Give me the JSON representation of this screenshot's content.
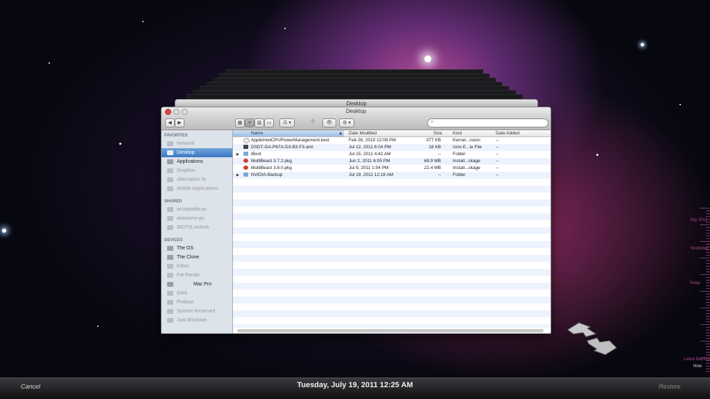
{
  "window": {
    "back_title": "Desktop",
    "title": "Desktop",
    "toolbar": {
      "back_label": "◀",
      "forward_label": "▶",
      "view_icons": [
        "icon-view-icon",
        "list-view-icon",
        "column-view-icon",
        "coverflow-view-icon"
      ],
      "arrange_label": "☰ ▾",
      "quicklook_label": "👁",
      "action_label": "⚙ ▾"
    }
  },
  "sidebar": {
    "sections": [
      {
        "title": "FAVORITES",
        "items": [
          {
            "label": "Network",
            "state": "dim"
          },
          {
            "label": "Desktop",
            "state": "selected"
          },
          {
            "label": "Applications",
            "state": "active"
          },
          {
            "label": "Dropbox",
            "state": "dim"
          },
          {
            "label": "Alternative To",
            "state": "dim"
          },
          {
            "label": "Mobile Applications",
            "state": "dim"
          }
        ]
      },
      {
        "title": "SHARED",
        "items": [
          {
            "label": "acceptable-pc",
            "state": "dim"
          },
          {
            "label": "awesome-pc",
            "state": "dim"
          },
          {
            "label": "WDTVLiveHub",
            "state": "dim"
          }
        ]
      },
      {
        "title": "DEVICES",
        "items": [
          {
            "label": "The OS",
            "state": "active"
          },
          {
            "label": "The Clone",
            "state": "active"
          },
          {
            "label": "Kitten",
            "state": "dim"
          },
          {
            "label": "Fat Panda",
            "state": "dim"
          },
          {
            "label": "Mac Pro",
            "state": "active"
          },
          {
            "label": "iDisk",
            "state": "dim"
          },
          {
            "label": "Preboot",
            "state": "dim"
          },
          {
            "label": "System Reserved",
            "state": "dim"
          },
          {
            "label": "Just Windows",
            "state": "dim"
          }
        ]
      }
    ]
  },
  "columns": {
    "name": "Name",
    "date": "Date Modified",
    "size": "Size",
    "kind": "Kind",
    "added": "Date Added"
  },
  "files": [
    {
      "name": "AppleIntelCPUPowerManagement.kext",
      "date": "Feb 26, 2010 12:08 PM",
      "size": "377 KB",
      "kind": "Kernel...nsion",
      "added": "--",
      "icon": "kext-icon",
      "color": "#e8e8e8",
      "expandable": false
    },
    {
      "name": "DSDT-GA-P67A-D3-B3-F3.aml",
      "date": "Jul 12, 2011 6:04 PM",
      "size": "18 KB",
      "kind": "Unix E...le File",
      "added": "--",
      "icon": "exec-icon",
      "color": "#444444",
      "expandable": false
    },
    {
      "name": "iBoot",
      "date": "Jul 15, 2011 4:42 AM",
      "size": "--",
      "kind": "Folder",
      "added": "--",
      "icon": "folder-icon",
      "color": "#7fa6d6",
      "expandable": true
    },
    {
      "name": "MultiBeast 3.7.2.pkg",
      "date": "Jun 2, 2011 6:05 PM",
      "size": "68.9 MB",
      "kind": "Install...ckage",
      "added": "--",
      "icon": "package-icon",
      "color": "#d23b2a",
      "expandable": false
    },
    {
      "name": "MultiBeast 3.8.0.pkg",
      "date": "Jul 9, 2011 1:54 PM",
      "size": "22.4 MB",
      "kind": "Install...ckage",
      "added": "--",
      "icon": "package-icon",
      "color": "#d23b2a",
      "expandable": false
    },
    {
      "name": "NVIDIA-Backup",
      "date": "Jul 19, 2011 12:18 AM",
      "size": "--",
      "kind": "Folder",
      "added": "--",
      "icon": "folder-icon",
      "color": "#7fa6d6",
      "expandable": true
    }
  ],
  "timemachine": {
    "cancel_label": "Cancel",
    "restore_label": "Restore",
    "current_date": "Tuesday, July 19, 2011 12:25 AM",
    "timeline": [
      "July 2011",
      "Yesterday",
      "Today",
      "Latest Backup",
      "Now"
    ]
  }
}
